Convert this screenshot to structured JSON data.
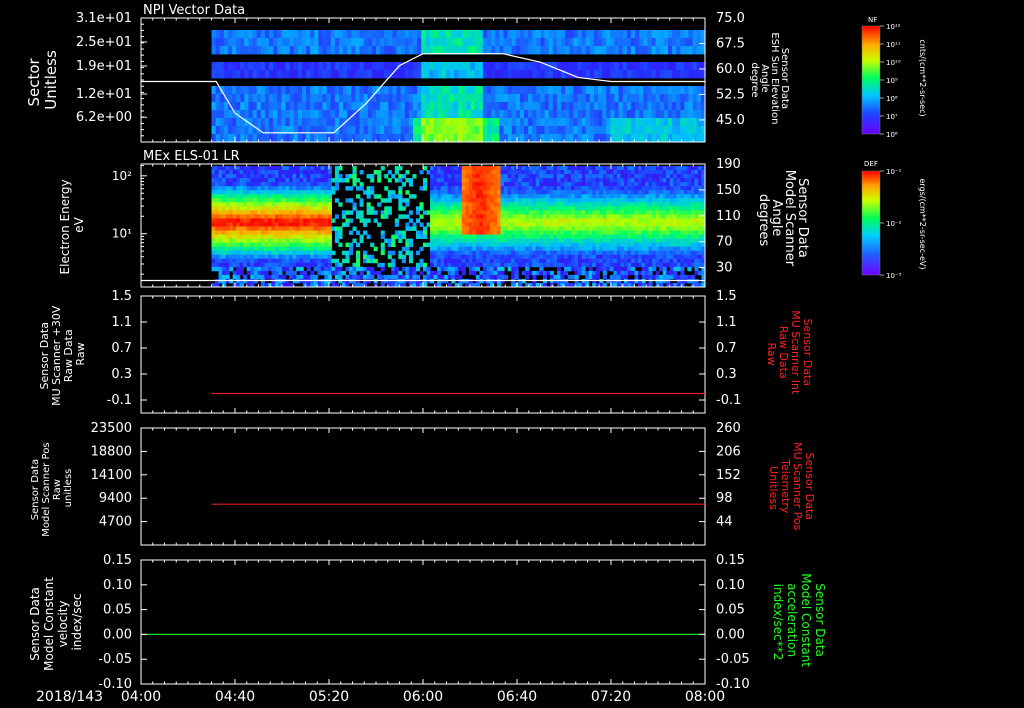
{
  "chart_data": {
    "type": "multi-panel",
    "time_axis": {
      "date_label": "2018/143",
      "ticks": [
        "04:00",
        "04:40",
        "05:20",
        "06:00",
        "06:40",
        "07:20",
        "08:00"
      ],
      "range": [
        "04:00",
        "08:00"
      ]
    },
    "panels": [
      {
        "type": "heatmap",
        "title": "NPI Vector Data",
        "ylabel": [
          "Sector",
          "Unitless"
        ],
        "yticks": [
          "3.1e+01",
          "2.5e+01",
          "1.9e+01",
          "1.2e+01",
          "6.2e+00"
        ],
        "ylim": [
          0,
          31
        ],
        "y2label": [
          "Sensor Data",
          "ESH Sun Elevation",
          "Angle",
          "degree"
        ],
        "y2ticks": [
          "75.0",
          "67.5",
          "60.0",
          "52.5",
          "45.0"
        ],
        "y2lim": [
          38.5,
          75
        ],
        "data_start": "04:30",
        "colorbar": {
          "label": "NF",
          "unit": "cnts/(cm**2-sr-sec)",
          "ticks": [
            "10¹²",
            "10¹¹",
            "10¹⁰",
            "10⁹",
            "10⁸",
            "10⁷",
            "10⁶"
          ]
        },
        "line_series": {
          "name": "ESH Sun Elevation",
          "color": "#ffffff",
          "x": [
            "04:00",
            "04:32",
            "04:40",
            "04:52",
            "05:10",
            "05:22",
            "05:36",
            "05:50",
            "06:00",
            "06:34",
            "06:50",
            "07:06",
            "07:20",
            "08:00"
          ],
          "y": [
            56.3,
            56.3,
            47.0,
            41.2,
            41.2,
            41.2,
            50.0,
            61.0,
            64.5,
            64.5,
            62.0,
            57.5,
            56.3,
            56.3
          ]
        }
      },
      {
        "type": "heatmap",
        "title": "MEx ELS-01 LR",
        "ylabel": [
          "Electron Energy",
          "eV"
        ],
        "yticks": [
          "10²",
          "10¹"
        ],
        "ylog": true,
        "ylim": [
          1.2,
          160
        ],
        "y2label": [
          "Sensor Data",
          "Model Scanner",
          "Angle",
          "degrees"
        ],
        "y2ticks": [
          "190",
          "150",
          "110",
          "70",
          "30"
        ],
        "y2lim": [
          0,
          190
        ],
        "data_start": "04:30",
        "colorbar": {
          "label": "DEF",
          "unit": "ergs/(cm**2-sr-sec-eV)",
          "ticks": [
            "10⁻¹",
            "10⁻²",
            "10⁻³"
          ]
        },
        "line_series": {
          "name": "Model Scanner Angle",
          "color": "#ffffff",
          "x": [
            "04:00",
            "08:00"
          ],
          "y": [
            10,
            10
          ]
        }
      },
      {
        "type": "line",
        "ylabel": [
          "Sensor Data",
          "MU Scanner +30V",
          "Raw Data",
          "Raw"
        ],
        "yticks": [
          "1.5",
          "1.1",
          "0.7",
          "0.3",
          "-0.1"
        ],
        "ylim": [
          -0.3,
          1.5
        ],
        "y2label": [
          "Sensor Data",
          "MU Scanner Int",
          "Raw Data",
          "Raw"
        ],
        "y2ticks": [
          "1.5",
          "1.1",
          "0.7",
          "0.3",
          "-0.1"
        ],
        "y2lim": [
          -0.3,
          1.5
        ],
        "y2color": "#ff2020",
        "series": [
          {
            "name": "MU Scanner Int",
            "color": "#dd2020",
            "x": [
              "04:30",
              "08:00"
            ],
            "y": [
              0.0,
              0.0
            ]
          }
        ]
      },
      {
        "type": "line",
        "ylabel": [
          "Sensor Data",
          "Model Scanner Pos",
          "Raw",
          "unitless"
        ],
        "yticks": [
          "23500",
          "18800",
          "14100",
          "9400",
          "4700"
        ],
        "ylim": [
          0,
          23500
        ],
        "y2label": [
          "Sensor Data",
          "MU Scanner Pos",
          "Telemetry",
          "Unitless"
        ],
        "y2ticks": [
          "260",
          "206",
          "152",
          "98",
          "44"
        ],
        "y2lim": [
          -10,
          260
        ],
        "y2color": "#ff2020",
        "series": [
          {
            "name": "MU Scanner Pos Telemetry",
            "color": "#dd2020",
            "x": [
              "04:30",
              "08:00"
            ],
            "y": [
              8200,
              8200
            ]
          }
        ]
      },
      {
        "type": "line",
        "ylabel": [
          "Sensor Data",
          "Model Constant",
          "velocity",
          "index/sec"
        ],
        "yticks": [
          "0.15",
          "0.10",
          "0.05",
          "0.00",
          "-0.05",
          "-0.10"
        ],
        "ylim": [
          -0.1,
          0.15
        ],
        "y2label": [
          "Sensor Data",
          "Model Constant",
          "acceleration",
          "index/sec**2"
        ],
        "y2ticks": [
          "0.15",
          "0.10",
          "0.05",
          "0.00",
          "-0.05",
          "-0.10"
        ],
        "y2lim": [
          -0.1,
          0.15
        ],
        "y2color": "#20ff20",
        "series": [
          {
            "name": "Model Constant acceleration",
            "color": "#20dd20",
            "x": [
              "04:00",
              "08:00"
            ],
            "y": [
              0.0,
              0.0
            ]
          }
        ]
      }
    ]
  }
}
